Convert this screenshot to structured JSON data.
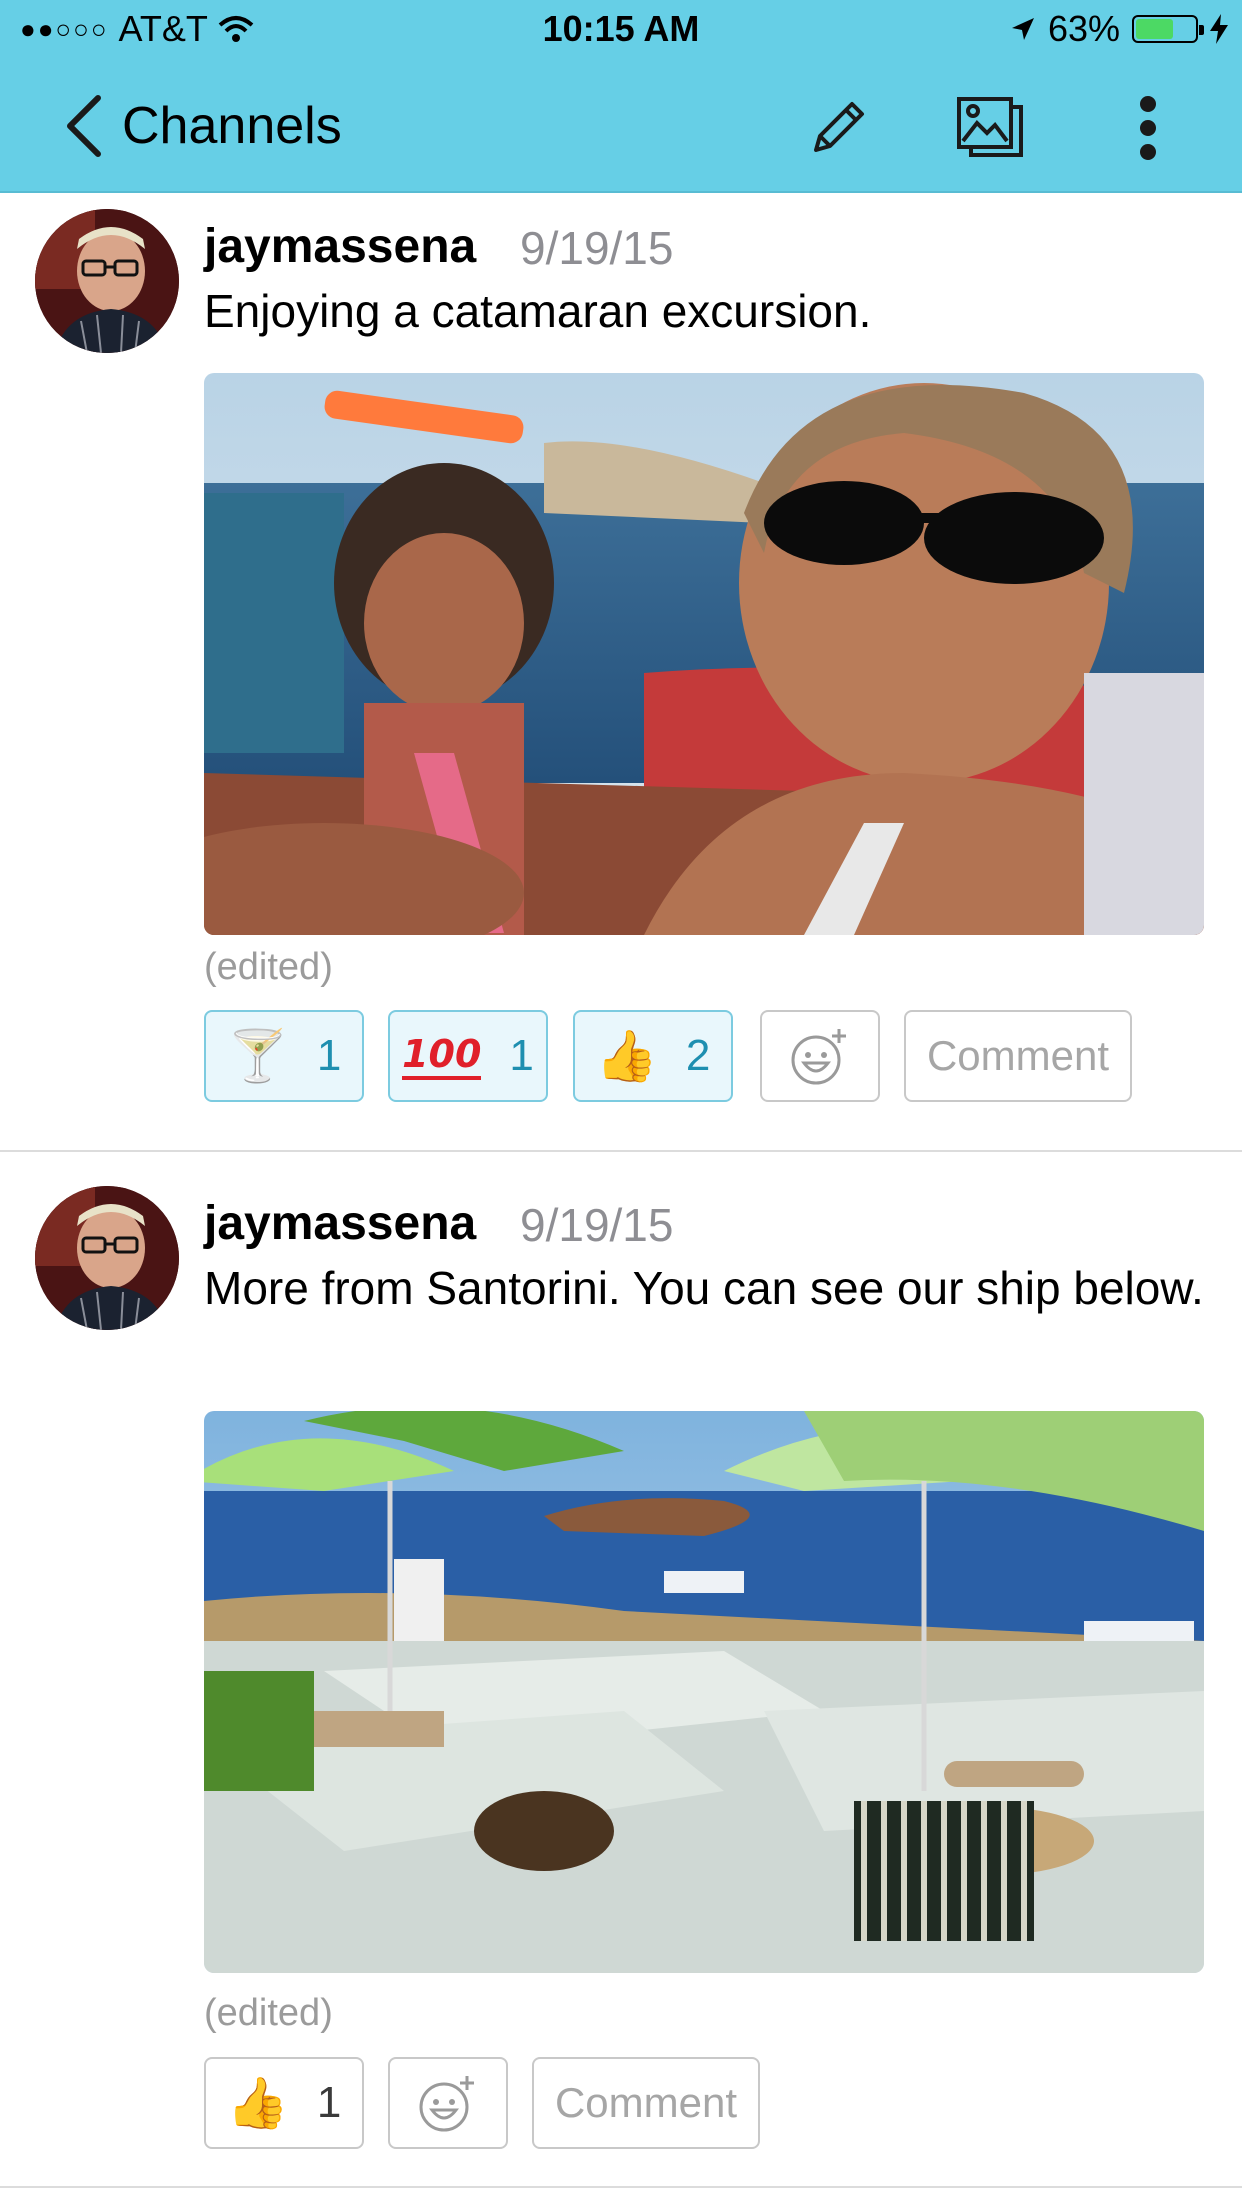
{
  "status_bar": {
    "signal": "●●○○○",
    "carrier": "AT&T",
    "time": "10:15 AM",
    "battery": "63%",
    "battery_level": 0.63
  },
  "nav": {
    "back_label": "Channels",
    "icons": [
      "pencil-icon",
      "gallery-icon",
      "more-icon"
    ]
  },
  "posts": [
    {
      "username": "jaymassena",
      "date": "9/19/15",
      "text": "Enjoying a catamaran excursion.",
      "edited": "(edited)",
      "reactions": [
        {
          "emoji": "🍸",
          "count": "1"
        },
        {
          "emoji": "100",
          "count": "1"
        },
        {
          "emoji": "👍",
          "count": "2"
        }
      ],
      "comment_label": "Comment"
    },
    {
      "username": "jaymassena",
      "date": "9/19/15",
      "text": "More from Santorini. You can see our ship below.",
      "edited": "(edited)",
      "reactions": [
        {
          "emoji": "👍",
          "count": "1"
        }
      ],
      "comment_label": "Comment"
    }
  ],
  "colors": {
    "header": "#66cfe6",
    "reaction_bg": "#e9f7fc",
    "reaction_border": "#7ccbe0",
    "reaction_text": "#1e8fb0"
  }
}
